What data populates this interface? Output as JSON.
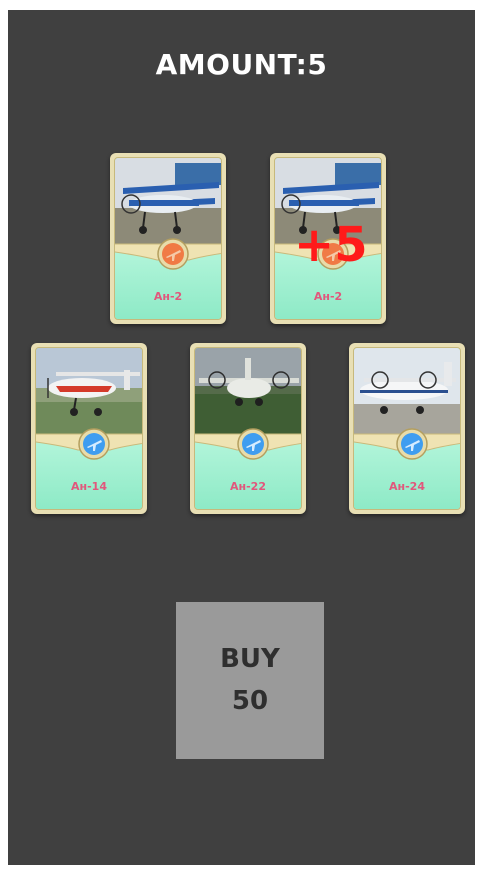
{
  "header": {
    "amount_text": "AMOUNT:5"
  },
  "cards": [
    {
      "name": "Ан-2",
      "badge_color": "#f07a45",
      "badge_icon": "plane-icon",
      "photo": "biplane"
    },
    {
      "name": "Ан-2",
      "badge_color": "#f07a45",
      "badge_icon": "plane-icon",
      "photo": "biplane"
    },
    {
      "name": "Ан-14",
      "badge_color": "#3f9df0",
      "badge_icon": "plane-icon",
      "photo": "small-twin"
    },
    {
      "name": "Ан-22",
      "badge_color": "#3f9df0",
      "badge_icon": "plane-icon",
      "photo": "large-turboprop"
    },
    {
      "name": "Ан-24",
      "badge_color": "#3f9df0",
      "badge_icon": "plane-icon",
      "photo": "regional-turboprop"
    }
  ],
  "overlay": {
    "bonus_text": "+5"
  },
  "buy": {
    "label": "BUY",
    "price": "50"
  },
  "colors": {
    "background": "#404040",
    "card_name": "#e1577c",
    "bonus": "#ff1a1a",
    "buy_button": "#9a9a9a"
  }
}
